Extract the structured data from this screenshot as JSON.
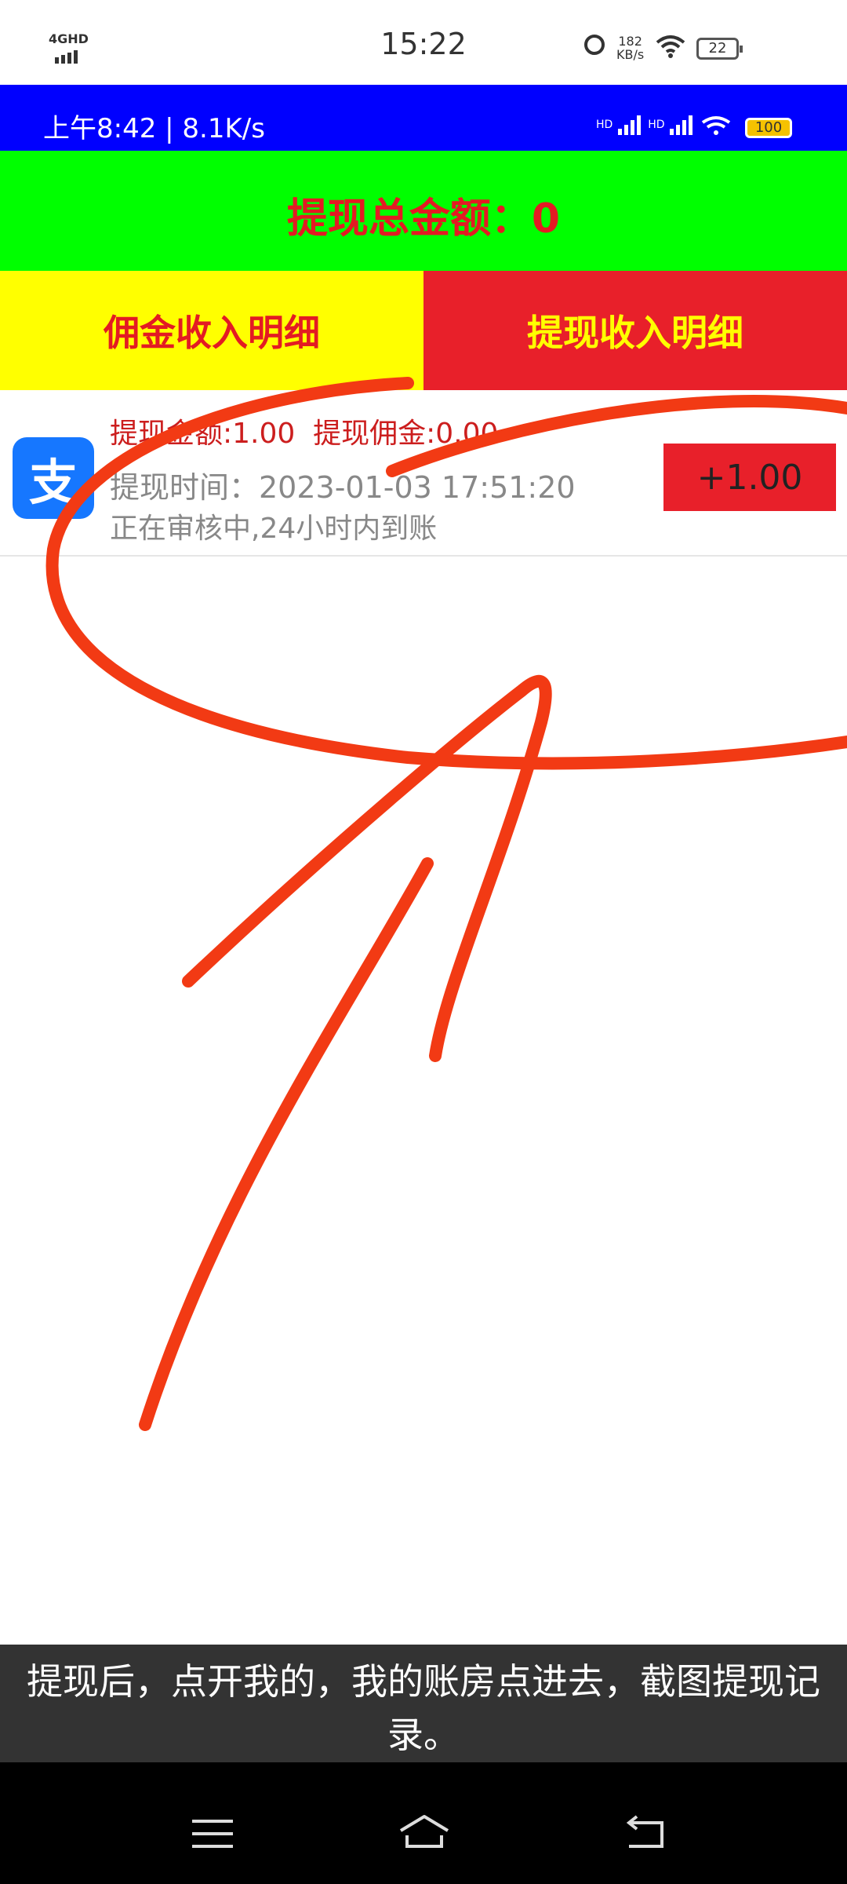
{
  "outer_status": {
    "network": "4GHD",
    "time": "15:22",
    "speed_value": "182",
    "speed_unit": "KB/s",
    "battery": "22"
  },
  "inner_status": {
    "time_speed": "上午8:42 | 8.1K/s",
    "signal1": "HD",
    "signal2": "HD",
    "battery": "100"
  },
  "total": {
    "label": "提现总金额：0"
  },
  "tabs": {
    "commission": "佣金收入明细",
    "withdraw": "提现收入明细"
  },
  "record": {
    "line1": "提现金额:1.00  提现佣金:0.00",
    "line2": "提现时间：2023-01-03 17:51:20",
    "line3": "正在审核中,24小时内到账",
    "amount": "+1.00",
    "icon_char": "支"
  },
  "caption": {
    "text": "提现后，点开我的，我的账房点进去，截图提现记录。"
  },
  "colors": {
    "inner_status_bg": "#0000ff",
    "total_bg": "#00ff00",
    "tab_commission_bg": "#ffff00",
    "tab_withdraw_bg": "#e8202a",
    "accent_red": "#e31b23",
    "scribble": "#f23a14"
  }
}
